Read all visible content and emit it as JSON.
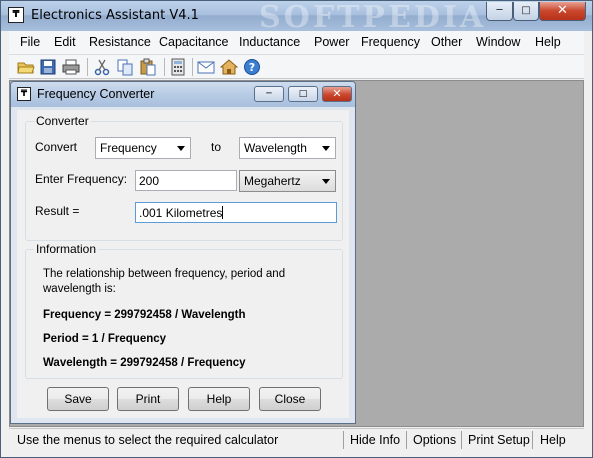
{
  "window": {
    "title": "Electronics Assistant V4.1",
    "watermark": "SOFTPEDIA",
    "app_icon_glyph": "₸"
  },
  "menu": [
    "File",
    "Edit",
    "Resistance",
    "Capacitance",
    "Inductance",
    "Power",
    "Frequency",
    "Other",
    "Window",
    "Help"
  ],
  "toolbar_icons": [
    "open-folder-icon",
    "save-icon",
    "print-icon",
    "cut-icon",
    "copy-icon",
    "paste-icon",
    "calculator-icon",
    "mail-icon",
    "home-icon",
    "help-icon"
  ],
  "dialog": {
    "title": "Frequency Converter",
    "converter_group": "Converter",
    "convert_label": "Convert",
    "from_unit": "Frequency",
    "to_label": "to",
    "to_unit": "Wavelength",
    "enter_label": "Enter Frequency:",
    "frequency_value": "200",
    "frequency_unit": "Megahertz",
    "result_label": "Result =",
    "result_value": ".001 Kilometres",
    "info_group": "Information",
    "info_line1": "The relationship between frequency, period and",
    "info_line2": "wavelength is:",
    "formula1": "Frequency = 299792458 / Wavelength",
    "formula2": "Period = 1 / Frequency",
    "formula3": "Wavelength = 299792458 / Frequency",
    "buttons": {
      "save": "Save",
      "print": "Print",
      "help": "Help",
      "close": "Close"
    }
  },
  "status": {
    "message": "Use the menus to select the required calculator",
    "hide_info": "Hide Info",
    "options": "Options",
    "print_setup": "Print Setup",
    "help": "Help"
  },
  "colors": {
    "accent": "#1c6fc2",
    "title_gradient": "#a9c0de",
    "close_red": "#c9462c"
  }
}
